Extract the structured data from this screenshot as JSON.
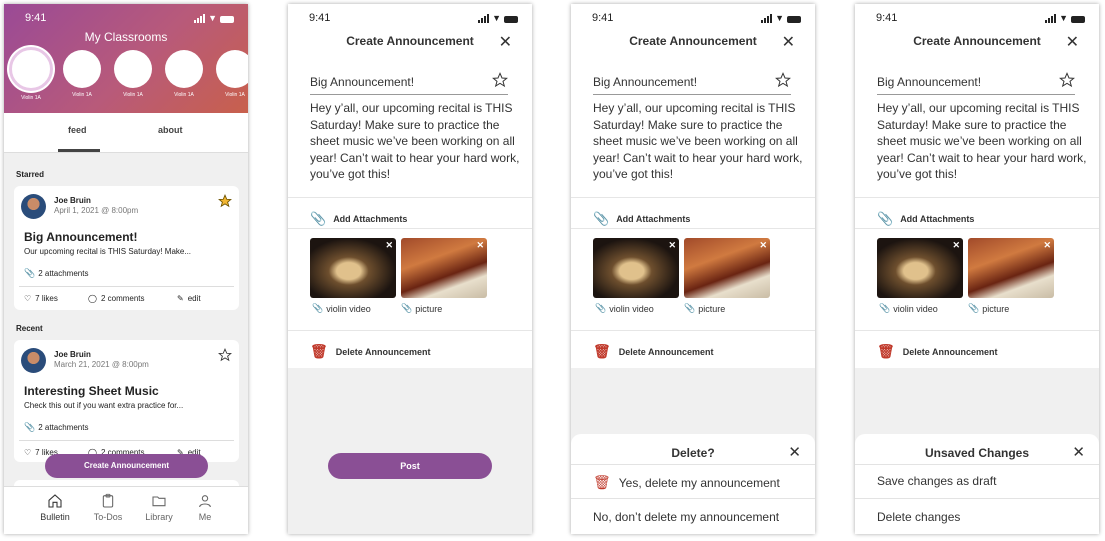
{
  "status": {
    "time": "9:41"
  },
  "home": {
    "title": "My Classrooms",
    "classrooms": [
      "Violin 1A",
      "Violin 1A",
      "Violin 1A",
      "Violin 1A",
      "Violin 1A"
    ],
    "tabs": [
      "feed",
      "about"
    ],
    "starred_heading": "Starred",
    "recent_heading": "Recent",
    "posts": [
      {
        "author": "Joe Bruin",
        "date": "April 1, 2021 @ 8:00pm",
        "title": "Big Announcement!",
        "body": "Our upcoming recital is THIS Saturday! Make...",
        "attachments": "2 attachments",
        "likes": "7 likes",
        "comments": "2 comments",
        "edit": "edit",
        "starred": true
      },
      {
        "author": "Joe Bruin",
        "date": "March 21, 2021 @ 8:00pm",
        "title": "Interesting Sheet Music",
        "body": "Check this out if you want extra practice for...",
        "attachments": "2 attachments",
        "likes": "7 likes",
        "comments": "2 comments",
        "edit": "edit",
        "starred": false
      }
    ],
    "create_button": "Create Announcement",
    "nav": [
      "Bulletin",
      "To-Dos",
      "Library",
      "Me"
    ]
  },
  "editor": {
    "header": "Create Announcement",
    "title": "Big Announcement!",
    "body": "Hey y’all, our upcoming recital is THIS Saturday! Make sure to practice the sheet music we’ve been working on all year! Can’t wait to hear your hard work, you’ve got this!",
    "add_attachments": "Add Attachments",
    "attachments": [
      "violin video",
      "picture"
    ],
    "delete_label": "Delete Announcement",
    "post_button": "Post"
  },
  "delete_sheet": {
    "title": "Delete?",
    "confirm": "Yes, delete my announcement",
    "cancel": "No, don’t delete my announcement"
  },
  "unsaved_sheet": {
    "title": "Unsaved Changes",
    "save": "Save changes as draft",
    "discard": "Delete changes"
  },
  "colors": {
    "accent": "#8a4f95",
    "danger": "#c0392b",
    "star_filled": "#f2b632"
  }
}
